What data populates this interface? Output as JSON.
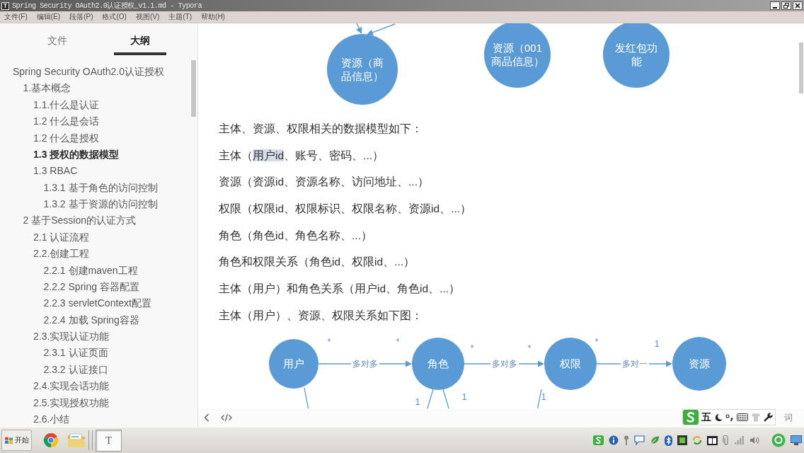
{
  "window": {
    "app_icon": "T",
    "title": "Spring Security OAuth2.0认证授权_v1.1.md - Typora"
  },
  "menu": [
    "文件(F)",
    "编辑(E)",
    "段落(P)",
    "格式(O)",
    "视图(V)",
    "主题(T)",
    "帮助(H)"
  ],
  "sidebar": {
    "tabs": [
      {
        "label": "文件",
        "selected": false
      },
      {
        "label": "大纲",
        "selected": true
      }
    ],
    "outline": [
      {
        "label": "Spring Security OAuth2.0认证授权",
        "selected": false,
        "children": [
          {
            "label": "1.基本概念",
            "selected": false,
            "children": [
              {
                "label": "1.1.什么是认证",
                "selected": false
              },
              {
                "label": "1.2 什么是会话",
                "selected": false
              },
              {
                "label": "1.2 什么是授权",
                "selected": false
              },
              {
                "label": "1.3 授权的数据模型",
                "selected": true
              },
              {
                "label": "1.3 RBAC",
                "selected": false,
                "children": [
                  {
                    "label": "1.3.1 基于角色的访问控制",
                    "selected": false
                  },
                  {
                    "label": "1.3.2 基于资源的访问控制",
                    "selected": false
                  }
                ]
              }
            ]
          },
          {
            "label": "2 基于Session的认证方式",
            "selected": false,
            "children": [
              {
                "label": "2.1 认证流程",
                "selected": false
              },
              {
                "label": "2.2.创建工程",
                "selected": false,
                "children": [
                  {
                    "label": "2.2.1 创建maven工程",
                    "selected": false
                  },
                  {
                    "label": "2.2.2 Spring 容器配置",
                    "selected": false
                  },
                  {
                    "label": "2.2.3 servletContext配置",
                    "selected": false
                  },
                  {
                    "label": "2.2.4 加载 Spring容器",
                    "selected": false
                  }
                ]
              },
              {
                "label": "2.3.实现认证功能",
                "selected": false,
                "children": [
                  {
                    "label": "2.3.1 认证页面",
                    "selected": false
                  },
                  {
                    "label": "2.3.2 认证接口",
                    "selected": false
                  }
                ]
              },
              {
                "label": "2.4.实现会话功能",
                "selected": false
              },
              {
                "label": "2.5.实现授权功能",
                "selected": false
              },
              {
                "label": "2.6.小结",
                "selected": false
              }
            ]
          }
        ]
      }
    ]
  },
  "document": {
    "top_diagram": {
      "nodes": [
        {
          "label": "资源（商品信息）"
        },
        {
          "label": "资源（001商品信息）"
        },
        {
          "label": "发红包功能"
        }
      ]
    },
    "paragraphs": [
      [
        {
          "text": "主体、资源、权限相关的数据模型如下：",
          "selected": false
        }
      ],
      [
        {
          "text": "主体（",
          "selected": false
        },
        {
          "text": "用户id",
          "selected": true
        },
        {
          "text": "、账号、密码、...）",
          "selected": false
        }
      ],
      [
        {
          "text": "资源（资源id、资源名称、访问地址、...）",
          "selected": false
        }
      ],
      [
        {
          "text": "权限（权限id、权限标识、权限名称、资源id、...）",
          "selected": false
        }
      ],
      [
        {
          "text": "角色（角色id、角色名称、...）",
          "selected": false
        }
      ],
      [
        {
          "text": "角色和权限关系（角色id、权限id、...）",
          "selected": false
        }
      ],
      [
        {
          "text": "主体（用户）和角色关系（用户id、角色id、...）",
          "selected": false
        }
      ],
      [
        {
          "text": "主体（用户）、资源、权限关系如下图：",
          "selected": false
        }
      ]
    ],
    "relation_diagram": {
      "nodes": [
        {
          "label": "用户"
        },
        {
          "label": "角色"
        },
        {
          "label": "权限"
        },
        {
          "label": "资源"
        }
      ],
      "edges": [
        {
          "label": "多对多",
          "source_mark": "*",
          "target_mark": "*"
        },
        {
          "label": "多对多",
          "source_mark": "*",
          "target_mark": "*"
        },
        {
          "label": "多对一",
          "source_mark": "*",
          "target_mark": "1"
        }
      ],
      "lower_marks": [
        "1",
        "1",
        "1"
      ]
    }
  },
  "status_bar": {
    "word_count": "词"
  },
  "ime_bar": {
    "mode": "五"
  },
  "taskbar": {
    "start_label": "开始",
    "buttons": [
      {
        "kind": "browser",
        "selected": false
      },
      {
        "kind": "folder",
        "selected": false
      },
      {
        "kind": "editor",
        "label": "T",
        "selected": true
      }
    ]
  }
}
